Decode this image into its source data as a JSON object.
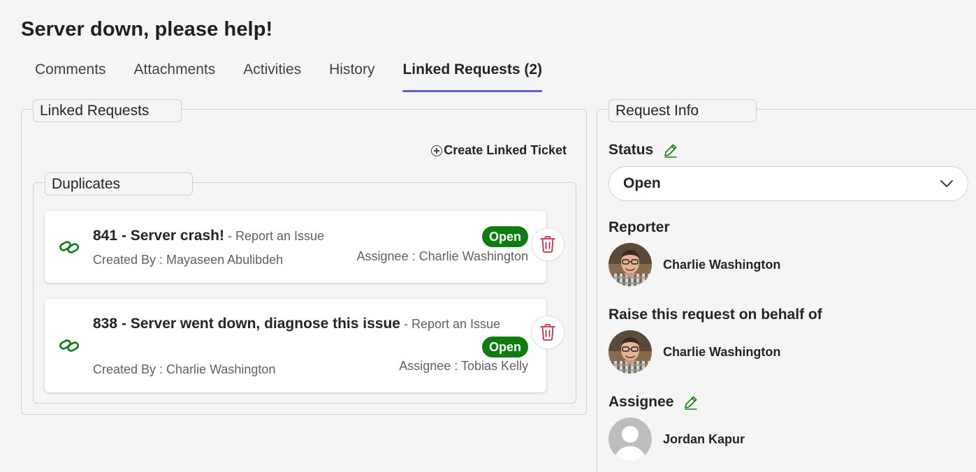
{
  "page_title": "Server down, please help!",
  "tabs": [
    {
      "label": "Comments"
    },
    {
      "label": "Attachments"
    },
    {
      "label": "Activities"
    },
    {
      "label": "History"
    },
    {
      "label": "Linked Requests (2)"
    }
  ],
  "linked": {
    "legend": "Linked Requests",
    "create_label": "Create Linked Ticket",
    "duplicates": {
      "legend": "Duplicates",
      "items": [
        {
          "title": "841 - Server crash!",
          "type": " - Report an Issue",
          "created_by": "Created By : Mayaseen Abulibdeh",
          "status": "Open",
          "assignee": "Assignee : Charlie Washington"
        },
        {
          "title": "838 - Server went down, diagnose this issue",
          "type": " - Report an Issue",
          "created_by": "Created By : Charlie Washington",
          "status": "Open",
          "assignee": "Assignee : Tobias Kelly"
        }
      ]
    }
  },
  "info": {
    "legend": "Request Info",
    "status_label": "Status",
    "status_value": "Open",
    "reporter_label": "Reporter",
    "reporter_name": "Charlie Washington",
    "behalf_label": "Raise this request on behalf of",
    "behalf_name": "Charlie Washington",
    "assignee_label": "Assignee",
    "assignee_name": "Jordan Kapur"
  },
  "colors": {
    "accent": "#5b5fc7",
    "status_open": "#107c10",
    "link_icon": "#107c10",
    "trash_icon": "#c4314b",
    "edit_icon": "#107c10"
  },
  "icons": [
    "plus-circle-icon",
    "link-icon",
    "trash-icon",
    "pencil-icon",
    "chevron-down-icon",
    "avatar-photo",
    "avatar-placeholder"
  ]
}
